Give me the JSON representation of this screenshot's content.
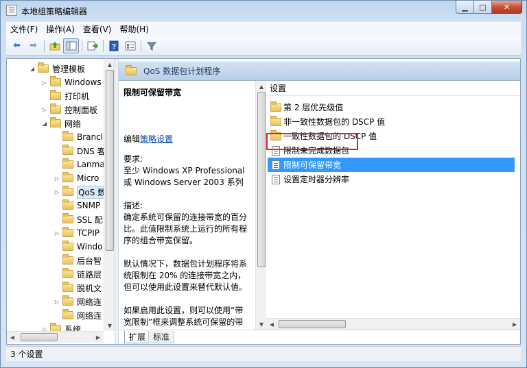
{
  "window": {
    "title": "本地组策略编辑器"
  },
  "menubar": [
    "文件(F)",
    "操作(A)",
    "查看(V)",
    "帮助(H)"
  ],
  "toolbar": {
    "icons": [
      "back-arrow-icon",
      "forward-arrow-icon",
      "up-folder-icon",
      "show-hide-tree-icon",
      "export-list-icon",
      "help-icon",
      "properties-icon",
      "filter-icon"
    ]
  },
  "tree": {
    "items": [
      {
        "label": "管理模板",
        "expander": "◢"
      },
      {
        "label": "Windows",
        "expander": "▷"
      },
      {
        "label": "打印机",
        "expander": ""
      },
      {
        "label": "控制面板",
        "expander": "▷"
      },
      {
        "label": "网络",
        "expander": "◢"
      },
      {
        "label": "Brancl",
        "expander": ""
      },
      {
        "label": "DNS 客",
        "expander": ""
      },
      {
        "label": "Lanma",
        "expander": ""
      },
      {
        "label": "Micro",
        "expander": "▷"
      },
      {
        "label": "QoS 数",
        "expander": "▷"
      },
      {
        "label": "SNMP",
        "expander": ""
      },
      {
        "label": "SSL 配",
        "expander": ""
      },
      {
        "label": "TCPIP",
        "expander": "▷"
      },
      {
        "label": "Windo",
        "expander": ""
      },
      {
        "label": "后台智",
        "expander": ""
      },
      {
        "label": "链路层",
        "expander": ""
      },
      {
        "label": "脱机文",
        "expander": ""
      },
      {
        "label": "网络连",
        "expander": "▷"
      },
      {
        "label": "网络连",
        "expander": ""
      },
      {
        "label": "系统",
        "expander": "▷"
      }
    ]
  },
  "right_pane": {
    "header_title": "QoS 数据包计划程序",
    "description": {
      "title": "限制可保留带宽",
      "edit_prefix": "编辑",
      "edit_link": "策略设置",
      "requirements_label": "要求:",
      "requirements": "至少 Windows XP Professional 或 Windows Server 2003 系列",
      "desc_label": "描述:",
      "desc_1": "确定系统可保留的连接带宽的百分比。此值限制系统上运行的所有程序的组合带宽保留。",
      "desc_2": "默认情况下，数据包计划程序将系统限制在 20% 的连接带宽之内，但可以使用此设置来替代默认值。",
      "desc_3": "如果启用此设置，则可以使用“带宽限制”框来调整系统可保留的带宽数量。"
    },
    "settings": {
      "column_header": "设置",
      "items": [
        {
          "label": "第 2 层优先级值",
          "type": "folder"
        },
        {
          "label": "非一致性数据包的 DSCP 值",
          "type": "folder"
        },
        {
          "label": "一致性数据包的 DSCP 值",
          "type": "folder"
        },
        {
          "label": "限制未完成数据包",
          "type": "setting"
        },
        {
          "label": "限制可保留带宽",
          "type": "setting",
          "selected": true
        },
        {
          "label": "设置定时器分辨率",
          "type": "setting"
        }
      ]
    },
    "tabs": [
      "扩展",
      "标准"
    ]
  },
  "statusbar": {
    "text": "3 个设置"
  },
  "colors": {
    "selection": "#3399ff",
    "highlight_box": "#e0222a",
    "link": "#0645ad"
  }
}
